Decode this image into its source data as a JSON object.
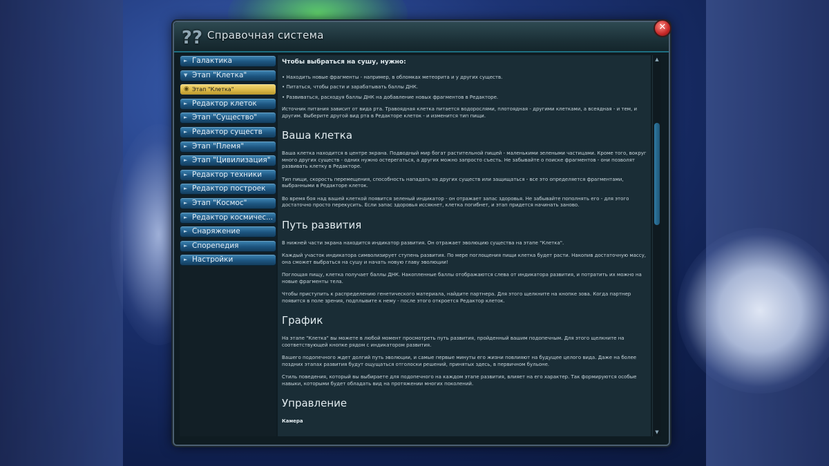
{
  "window": {
    "title": "Справочная система",
    "title_icon": "??",
    "close_label": "✕"
  },
  "sidebar": {
    "items": [
      {
        "label": "Галактика",
        "state": "collapsed"
      },
      {
        "label": "Этап \"Клетка\"",
        "state": "expanded"
      },
      {
        "label": "Этап \"Клетка\"",
        "state": "selected"
      },
      {
        "label": "Редактор клеток",
        "state": "collapsed"
      },
      {
        "label": "Этап \"Существо\"",
        "state": "collapsed"
      },
      {
        "label": "Редактор существ",
        "state": "collapsed"
      },
      {
        "label": "Этап \"Племя\"",
        "state": "collapsed"
      },
      {
        "label": "Этап \"Цивилизация\"",
        "state": "collapsed"
      },
      {
        "label": "Редактор техники",
        "state": "collapsed"
      },
      {
        "label": "Редактор построек",
        "state": "collapsed"
      },
      {
        "label": "Этап \"Космос\"",
        "state": "collapsed"
      },
      {
        "label": "Редактор космичес...",
        "state": "collapsed"
      },
      {
        "label": "Снаряжение",
        "state": "collapsed"
      },
      {
        "label": "Спорепедия",
        "state": "collapsed"
      },
      {
        "label": "Настройки",
        "state": "collapsed"
      }
    ]
  },
  "content": {
    "lead": "Чтобы выбраться на сушу, нужно:",
    "bullets": [
      "• Находить новые фрагменты - например, в обломках метеорита и у других существ.",
      "• Питаться, чтобы расти и зарабатывать баллы ДНК.",
      "• Развиваться, расходуя баллы ДНК на добавление новых фрагментов в Редакторе."
    ],
    "intro_para": "Источник питания зависит от вида рта. Травоядная клетка питается водорослями, плотоядная - другими клетками, а всеядная - и тем, и другим. Выберите другой вид рта в Редакторе клеток - и изменится тип пищи.",
    "sections": [
      {
        "heading": "Ваша клетка",
        "paragraphs": [
          "Ваша клетка находится в центре экрана. Подводный мир богат растительной пищей - маленькими зелеными частицами. Кроме того, вокруг много других существ - одних нужно остерегаться, а других можно запросто съесть. Не забывайте о поиске фрагментов - они позволят развивать клетку в Редакторе.",
          "Тип пищи, скорость перемещения, способность нападать на других существ или защищаться - все это определяется фрагментами, выбранными в Редакторе клеток.",
          "Во время боя над вашей клеткой появится зеленый индикатор - он отражает запас здоровья. Не забывайте пополнять его - для этого достаточно просто перекусить. Если запас здоровья иссякнет, клетка погибнет, и этап придется начинать заново."
        ]
      },
      {
        "heading": "Путь развития",
        "paragraphs": [
          "В нижней части экрана находится индикатор развития. Он отражает эволюцию существа на этапе \"Клетка\".",
          "Каждый участок индикатора символизирует ступень развития. По мере поглощения пищи клетка будет расти. Накопив достаточную массу, она сможет выбраться на сушу и начать новую главу эволюции!",
          "Поглощая пищу, клетка получает баллы ДНК. Накопленные баллы отображаются слева от индикатора развития, и потратить их можно на новые фрагменты тела.",
          "Чтобы приступить к распределению генетического материала, найдите партнера. Для этого щелкните на кнопке зова. Когда партнер появится в поле зрения, подплывите к нему - после этого откроется Редактор клеток."
        ]
      },
      {
        "heading": "График",
        "paragraphs": [
          "На этапе \"Клетка\" вы можете в любой момент просмотреть путь развития, пройденный вашим подопечным. Для этого щелкните на соответствующей кнопке рядом с индикатором развития.",
          "Вашего подопечного ждет долгий путь эволюции, и самые первые минуты его жизни повлияют на будущее целого вида. Даже на более поздних этапах развития будут ощущаться отголоски решений, принятых здесь, в первичном бульоне.",
          "Стиль поведения, который вы выбираете для подопечного на каждом этапе развития, влияет на его характер. Так формируются особые навыки, которыми будет обладать вид на протяжении многих поколений."
        ]
      },
      {
        "heading": "Управление",
        "paragraphs": []
      }
    ],
    "subheading": "Камера"
  },
  "scrollbar": {
    "up_label": "▲",
    "down_label": "▼"
  }
}
